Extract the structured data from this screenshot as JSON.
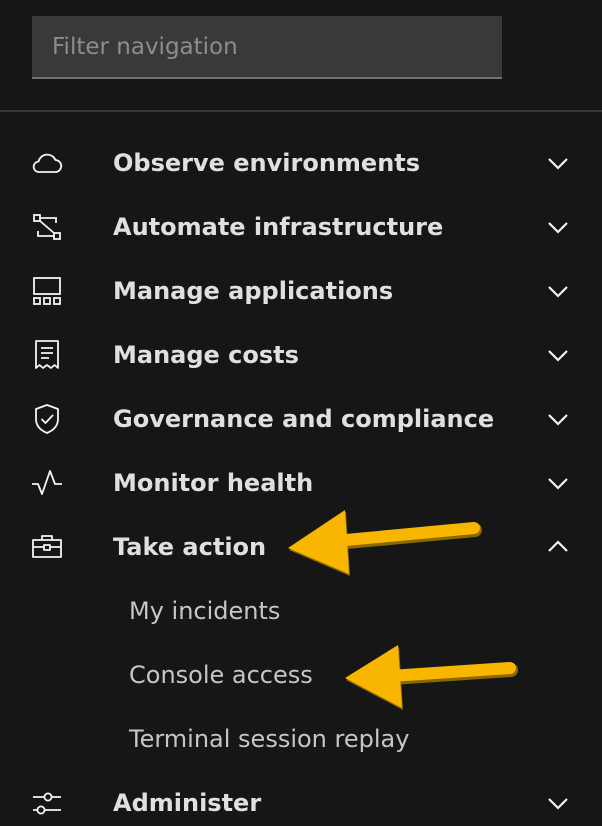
{
  "filter": {
    "placeholder": "Filter navigation",
    "value": ""
  },
  "nav": {
    "items": [
      {
        "label": "Observe environments",
        "icon": "cloud-icon",
        "expanded": false
      },
      {
        "label": "Automate infrastructure",
        "icon": "flow-icon",
        "expanded": false
      },
      {
        "label": "Manage applications",
        "icon": "app-grid-icon",
        "expanded": false
      },
      {
        "label": "Manage costs",
        "icon": "receipt-icon",
        "expanded": false
      },
      {
        "label": "Governance and compliance",
        "icon": "shield-check-icon",
        "expanded": false
      },
      {
        "label": "Monitor health",
        "icon": "activity-icon",
        "expanded": false
      },
      {
        "label": "Take action",
        "icon": "toolbox-icon",
        "expanded": true,
        "children": [
          {
            "label": "My incidents"
          },
          {
            "label": "Console access"
          },
          {
            "label": "Terminal session replay"
          }
        ]
      },
      {
        "label": "Administer",
        "icon": "settings-adjust-icon",
        "expanded": false
      }
    ]
  },
  "colors": {
    "background": "#161616",
    "input_background": "#393939",
    "text_primary": "#e0e0e0",
    "text_secondary": "#c6c6c6",
    "annotation_arrow": "#f8b600"
  }
}
